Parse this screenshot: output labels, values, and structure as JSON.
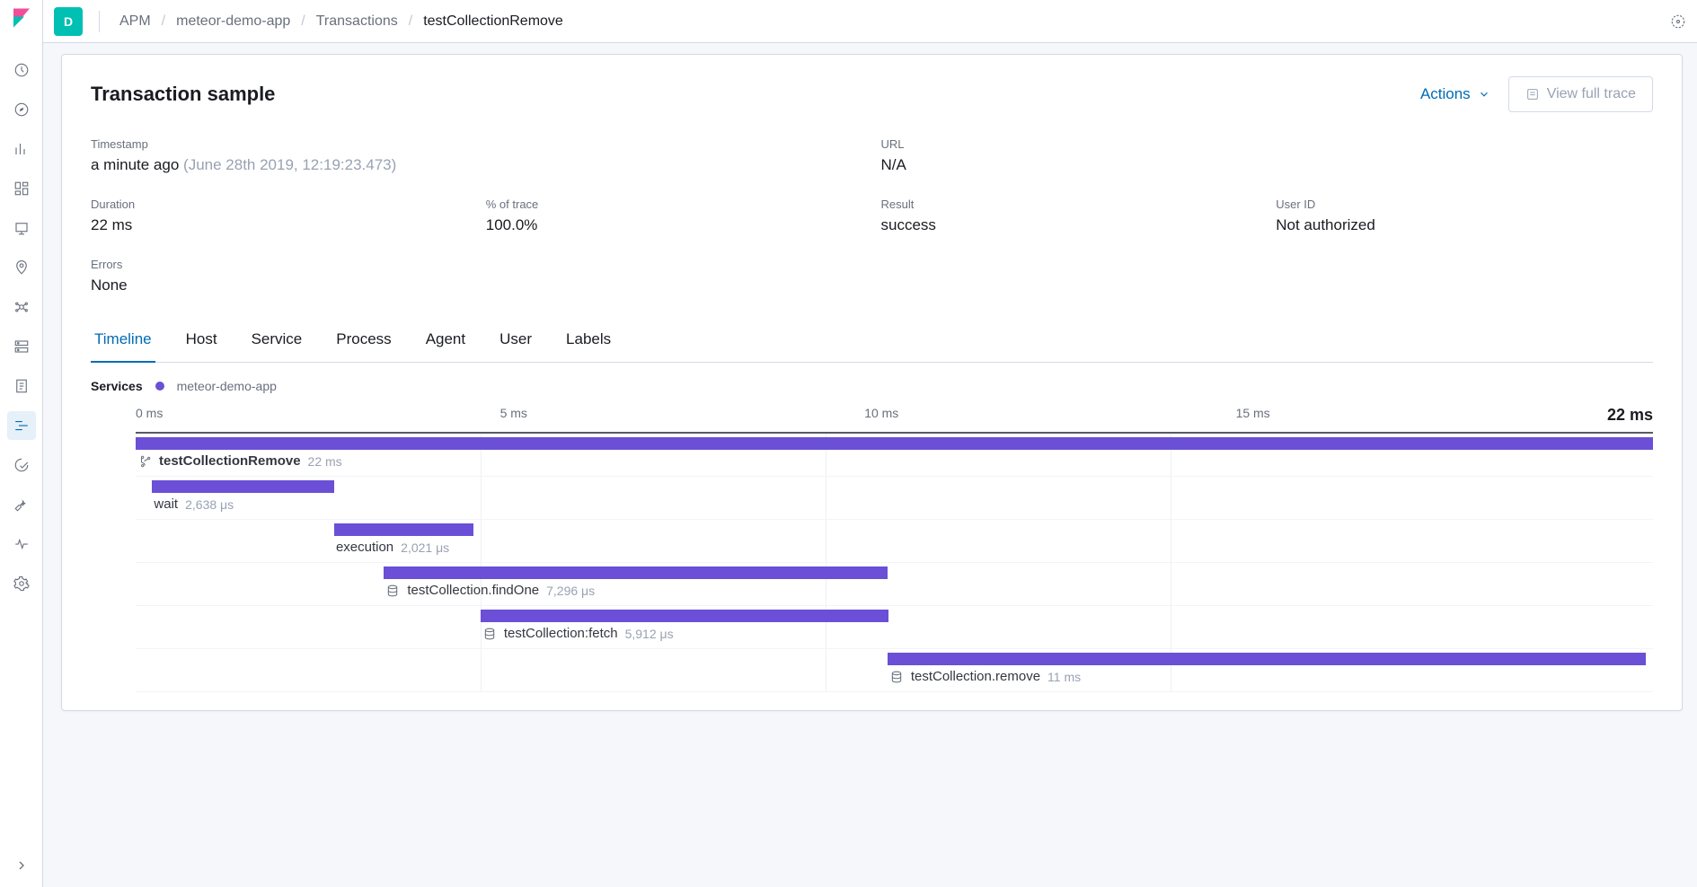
{
  "accent": "#6b4fd6",
  "service_color": "#6b4fd6",
  "space_badge": "D",
  "breadcrumb": [
    "APM",
    "meteor-demo-app",
    "Transactions",
    "testCollectionRemove"
  ],
  "page_title": "Transaction sample",
  "actions_label": "Actions",
  "view_trace_label": "View full trace",
  "summary": {
    "timestamp_label": "Timestamp",
    "timestamp_relative": "a minute ago",
    "timestamp_abs": "(June 28th 2019, 12:19:23.473)",
    "url_label": "URL",
    "url_value": "N/A",
    "duration_label": "Duration",
    "duration_value": "22 ms",
    "trace_pct_label": "% of trace",
    "trace_pct_value": "100.0%",
    "result_label": "Result",
    "result_value": "success",
    "userid_label": "User ID",
    "userid_value": "Not authorized",
    "errors_label": "Errors",
    "errors_value": "None"
  },
  "tabs": [
    "Timeline",
    "Host",
    "Service",
    "Process",
    "Agent",
    "User",
    "Labels"
  ],
  "active_tab": 0,
  "services_label": "Services",
  "service_name": "meteor-demo-app",
  "axis": {
    "ticks": [
      "0 ms",
      "5 ms",
      "10 ms",
      "15 ms"
    ],
    "max_label": "22 ms",
    "max_ms": 22
  },
  "spans": [
    {
      "name": "testCollectionRemove",
      "dur": "22 ms",
      "start_ms": 0,
      "len_ms": 22,
      "bold": true,
      "icon": "branch",
      "label_offset_ms": 0
    },
    {
      "name": "wait",
      "dur": "2,638 μs",
      "start_ms": 0.24,
      "len_ms": 2.638,
      "bold": false,
      "icon": null,
      "label_offset_ms": 0.24
    },
    {
      "name": "execution",
      "dur": "2,021 μs",
      "start_ms": 2.878,
      "len_ms": 2.021,
      "bold": false,
      "icon": null,
      "label_offset_ms": 2.878
    },
    {
      "name": "testCollection.findOne",
      "dur": "7,296 μs",
      "start_ms": 3.6,
      "len_ms": 7.296,
      "bold": false,
      "icon": "db",
      "label_offset_ms": 3.6
    },
    {
      "name": "testCollection:fetch",
      "dur": "5,912 μs",
      "start_ms": 5.0,
      "len_ms": 5.912,
      "bold": false,
      "icon": "db",
      "label_offset_ms": 5.0
    },
    {
      "name": "testCollection.remove",
      "dur": "11 ms",
      "start_ms": 10.9,
      "len_ms": 11.0,
      "bold": false,
      "icon": "db",
      "label_offset_ms": 10.9
    }
  ]
}
